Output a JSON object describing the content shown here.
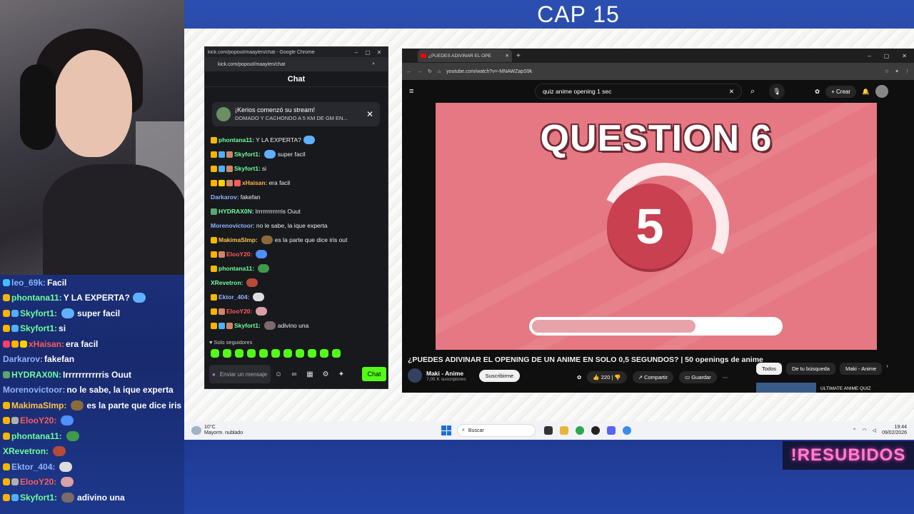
{
  "stream": {
    "title": "CAP 15",
    "brand": "!RESUBIDOS"
  },
  "overlay_chat": [
    {
      "user": "leo_69k",
      "color": "#7fb7ff",
      "badges": [
        "#3fbfff"
      ],
      "message": "Facil",
      "emote": null
    },
    {
      "user": "phontana11",
      "color": "#6dff9b",
      "badges": [
        "#f5b800"
      ],
      "message": "Y LA EXPERTA?",
      "emote": "#5fb0ff"
    },
    {
      "user": "Skyfort1",
      "color": "#6dff9b",
      "badges": [
        "#ffb300",
        "#4fb0ff"
      ],
      "message": "super facil",
      "emote": "#5fb0ff",
      "emote_first": true
    },
    {
      "user": "Skyfort1",
      "color": "#6dff9b",
      "badges": [
        "#ffb300",
        "#4fb0ff"
      ],
      "message": "si",
      "emote": null
    },
    {
      "user": "xHaisan",
      "color": "#ff5a5a",
      "badges": [
        "#ff3b6b",
        "#ffb300",
        "#ffcf00"
      ],
      "message": "era facil",
      "emote": null
    },
    {
      "user": "Darkarov",
      "color": "#8fb3ff",
      "badges": [],
      "message": "fakefan",
      "emote": null
    },
    {
      "user": "HYDRAX0N",
      "color": "#6dff9b",
      "badges": [
        "#5aa86a"
      ],
      "message": "Irrrrrrrrrrris Ouut",
      "emote": null
    },
    {
      "user": "Morenovictoor",
      "color": "#8fb3ff",
      "badges": [],
      "message": "no le sabe, la ique experta",
      "emote": null
    },
    {
      "user": "MakimaSImp",
      "color": "#ffc34d",
      "badges": [
        "#f5b800"
      ],
      "message": "es la parte que dice iris o",
      "emote": "#8a6a3a",
      "emote_first": true
    },
    {
      "user": "ElooY20",
      "color": "#ff5a5a",
      "badges": [
        "#ffb300",
        "#b0b0b0"
      ],
      "message": "",
      "emote": "#4f8fff"
    },
    {
      "user": "phontana11",
      "color": "#6dff9b",
      "badges": [
        "#f5b800"
      ],
      "message": "",
      "emote": "#3f9a4a"
    },
    {
      "user": "XRevetron",
      "color": "#6dff9b",
      "badges": [],
      "message": "",
      "emote": "#b84a3a"
    },
    {
      "user": "Ektor_404",
      "color": "#8fb3ff",
      "badges": [
        "#f5b800"
      ],
      "message": "",
      "emote": "#dddddd"
    },
    {
      "user": "ElooY20",
      "color": "#ff5a5a",
      "badges": [
        "#ffb300",
        "#b0b0b0"
      ],
      "message": "",
      "emote": "#d9a0a8"
    },
    {
      "user": "Skyfort1",
      "color": "#6dff9b",
      "badges": [
        "#ffb300",
        "#4fb0ff"
      ],
      "message": "adivino una",
      "emote": "#7a6a6a",
      "emote_first": true
    }
  ],
  "kick": {
    "window_title": "kick.com/popout/maaylen/chat - Google Chrome",
    "url": "kick.com/popout/maaylen/chat",
    "header": "Chat",
    "notice": {
      "title": "¡Kerios comenzó su stream!",
      "text": "DOMADO Y CACHONDO A 5 KM DE GM EN..."
    },
    "messages": [
      {
        "user": "phontana11",
        "color": "#6dff9b",
        "badges": [
          "#f5b800"
        ],
        "message": "Y LA EXPERTA?",
        "emote": "#5fb0ff"
      },
      {
        "user": "Skyfort1",
        "color": "#6dff9b",
        "badges": [
          "#ffb300",
          "#4fb0ff",
          "#cc8866"
        ],
        "message": "super facil",
        "emote": "#5fb0ff",
        "emote_first": true
      },
      {
        "user": "Skyfort1",
        "color": "#6dff9b",
        "badges": [
          "#ffb300",
          "#4fb0ff",
          "#cc8866"
        ],
        "message": "si",
        "emote": null
      },
      {
        "user": "xHaisan",
        "color": "#ffb347",
        "badges": [
          "#ffb300",
          "#ffcf00",
          "#cc8866",
          "#ff5a5a"
        ],
        "message": "era facil",
        "emote": null
      },
      {
        "user": "Darkarov",
        "color": "#8fb3ff",
        "badges": [],
        "message": "fakefan",
        "emote": null
      },
      {
        "user": "HYDRAX0N",
        "color": "#6dff9b",
        "badges": [
          "#5aa86a"
        ],
        "message": "Irrrrrrrrrrrris Ouut",
        "emote": null
      },
      {
        "user": "Morenovictoor",
        "color": "#8fb3ff",
        "badges": [],
        "message": "no le sabe, la ique experta",
        "emote": null
      },
      {
        "user": "MakimaSImp",
        "color": "#ffc34d",
        "badges": [
          "#f5b800"
        ],
        "message": "es la parte que dice iris out",
        "emote": "#8a6a3a",
        "emote_first": true
      },
      {
        "user": "ElooY20",
        "color": "#ff5a5a",
        "badges": [
          "#ffb300",
          "#cc8866"
        ],
        "message": "",
        "emote": "#4f8fff"
      },
      {
        "user": "phontana11",
        "color": "#6dff9b",
        "badges": [
          "#f5b800"
        ],
        "message": "",
        "emote": "#3f9a4a"
      },
      {
        "user": "XRevetron",
        "color": "#6dff9b",
        "badges": [],
        "message": "",
        "emote": "#b84a3a"
      },
      {
        "user": "Ektor_404",
        "color": "#8fb3ff",
        "badges": [
          "#f5b800"
        ],
        "message": "",
        "emote": "#dddddd"
      },
      {
        "user": "ElooY20",
        "color": "#ff5a5a",
        "badges": [
          "#ffb300",
          "#cc8866"
        ],
        "message": "",
        "emote": "#d9a0a8"
      },
      {
        "user": "Skyfort1",
        "color": "#6dff9b",
        "badges": [
          "#ffb300",
          "#4fb0ff",
          "#cc8866"
        ],
        "message": "adivino una",
        "emote": "#7a6a6a",
        "emote_first": true
      }
    ],
    "followers_only": "Solo seguidores",
    "input_placeholder": "Enviar un mensaje",
    "send_label": "Chat"
  },
  "youtube": {
    "tab_title": "¿PUEDES ADIVINAR EL OPE",
    "url": "youtube.com/watch?v=-MNAWZapS9k",
    "search_value": "quiz anime opening 1 sec",
    "create_label": "Crear",
    "player": {
      "question": "QUESTION 6",
      "countdown": "5",
      "progress": 0.66
    },
    "video_title": "¿PUEDES ADIVINAR EL OPENING DE UN ANIME EN SOLO 0,5 SEGUNDOS? | 50 openings de anime",
    "channel": {
      "name": "Maki - Anime",
      "subs": "7,05 K suscriptores",
      "subscribe": "Suscribirme"
    },
    "likes": "220",
    "share": "Compartir",
    "save": "Guardar",
    "chips": [
      "Todos",
      "De tu búsqueda",
      "Maki - Anime"
    ],
    "rec_title": "ULTIMATE ANIME QUIZ"
  },
  "taskbar": {
    "temp": "10°C",
    "weather": "Mayorm. nublado",
    "search": "Buscar",
    "time": "19:44",
    "date": "09/02/2026"
  }
}
